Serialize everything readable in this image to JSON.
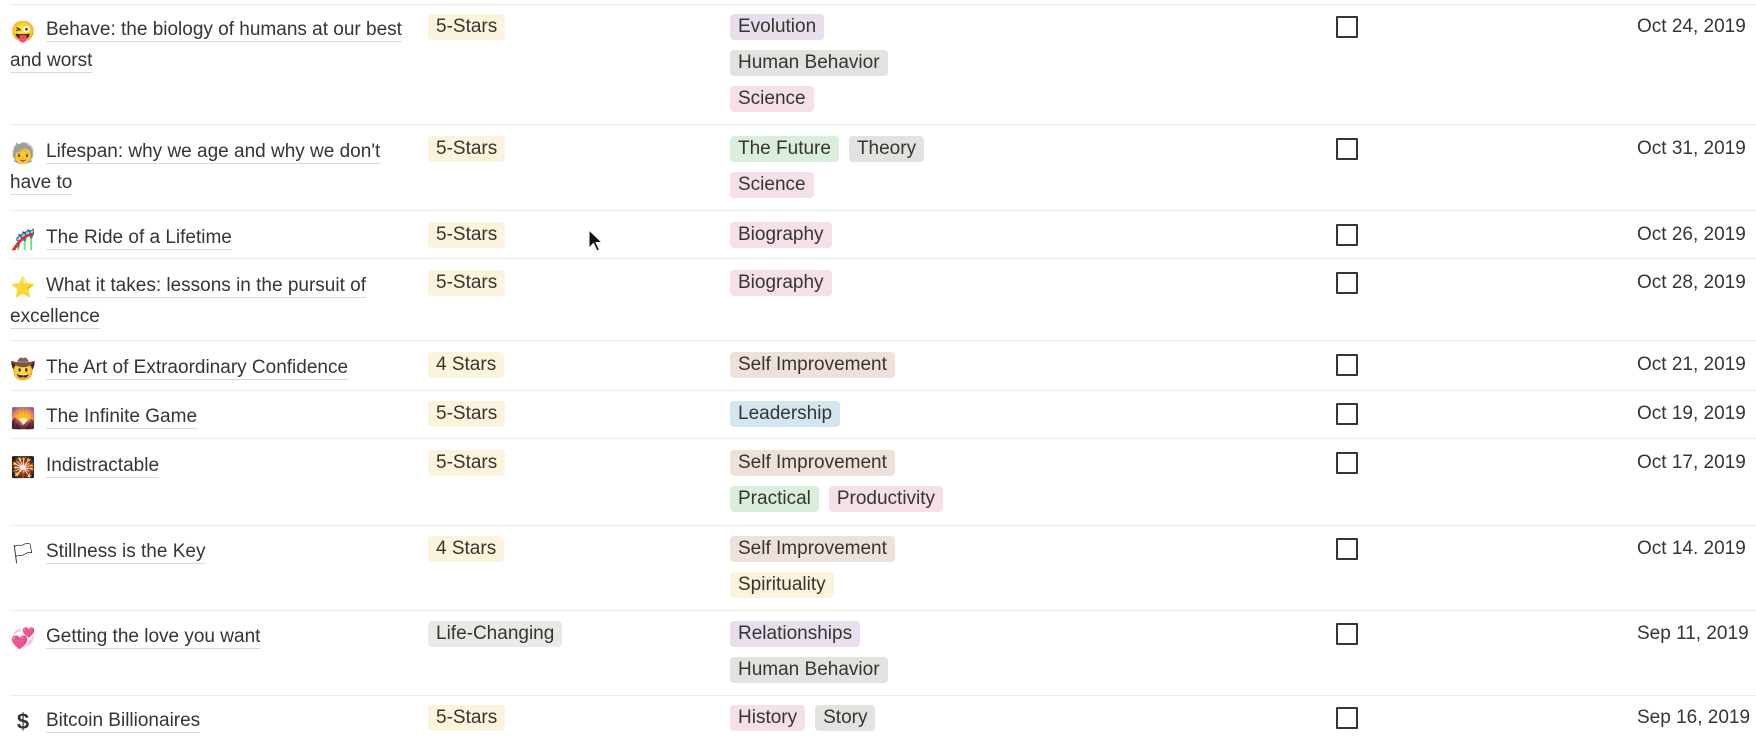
{
  "colors": {
    "star5": "#fbf3db",
    "star4": "#fbf3db",
    "lifechanging": "#e9e9e7",
    "purple": "#e8deee",
    "gray": "#e3e2e0",
    "pink": "#f5e0e9",
    "green": "#dbeddb",
    "brown": "#eee0da",
    "orange": "#fadec9",
    "blue": "#d3e5ef",
    "yellow": "#fbf3db"
  },
  "books": [
    {
      "emoji": "😜",
      "icon": "silly-face-icon",
      "title": "Behave: the biology of humans at our best and worst",
      "rating": "5-Stars",
      "tags": [
        [
          "Evolution"
        ],
        [
          "Human Behavior"
        ],
        [
          "Science"
        ]
      ],
      "date": "Oct 24, 2019"
    },
    {
      "emoji": "🧓",
      "icon": "elder-icon",
      "title": "Lifespan: why we age and why we don't have to",
      "rating": "5-Stars",
      "tags": [
        [
          "The Future",
          "Theory"
        ],
        [
          "Science"
        ]
      ],
      "date": "Oct 31, 2019"
    },
    {
      "emoji": "🎢",
      "icon": "rollercoaster-icon",
      "title": "The Ride of a Lifetime",
      "rating": "5-Stars",
      "tags": [
        [
          "Biography"
        ]
      ],
      "date": "Oct 26, 2019"
    },
    {
      "emoji": "⭐",
      "icon": "star-icon",
      "title": "What it takes: lessons in the pursuit of excellence",
      "rating": "5-Stars",
      "tags": [
        [
          "Biography"
        ]
      ],
      "date": "Oct 28, 2019"
    },
    {
      "emoji": "🤠",
      "icon": "cowboy-icon",
      "title": "The Art of Extraordinary Confidence",
      "rating": "4 Stars",
      "tags": [
        [
          "Self Improvement"
        ]
      ],
      "date": "Oct 21, 2019"
    },
    {
      "emoji": "🌄",
      "icon": "sunrise-icon",
      "title": "The Infinite Game",
      "rating": "5-Stars",
      "tags": [
        [
          "Leadership"
        ]
      ],
      "date": "Oct 19, 2019"
    },
    {
      "emoji": "🎇",
      "icon": "firework-icon",
      "title": "Indistractable",
      "rating": "5-Stars",
      "tags": [
        [
          "Self Improvement"
        ],
        [
          "Practical",
          "Productivity"
        ]
      ],
      "date": "Oct 17, 2019"
    },
    {
      "emoji": "🏳",
      "icon": "white-flag-icon",
      "title": "Stillness is the Key",
      "rating": "4 Stars",
      "tags": [
        [
          "Self Improvement"
        ],
        [
          "Spirituality"
        ]
      ],
      "date": "Oct 14. 2019"
    },
    {
      "emoji": "💞",
      "icon": "hearts-icon",
      "title": "Getting the love you want",
      "rating": "Life-Changing",
      "tags": [
        [
          "Relationships"
        ],
        [
          "Human Behavior"
        ]
      ],
      "date": "Sep 11, 2019"
    },
    {
      "emoji": "$",
      "icon": "dollar-icon",
      "title": "Bitcoin Billionaires",
      "rating": "5-Stars",
      "tags": [
        [
          "History",
          "Story"
        ]
      ],
      "date": "Sep 16, 2019"
    }
  ],
  "tag_colors": {
    "Evolution": "purple",
    "Human Behavior": "gray",
    "Science": "pink",
    "The Future": "green",
    "Theory": "gray",
    "Biography": "pink",
    "Self Improvement": "brown",
    "Leadership": "blue",
    "Practical": "green",
    "Productivity": "pink",
    "Spirituality": "yellow",
    "Relationships": "purple",
    "History": "pink",
    "Story": "gray"
  },
  "rating_colors": {
    "5-Stars": "star5",
    "4 Stars": "star4",
    "Life-Changing": "lifechanging"
  }
}
